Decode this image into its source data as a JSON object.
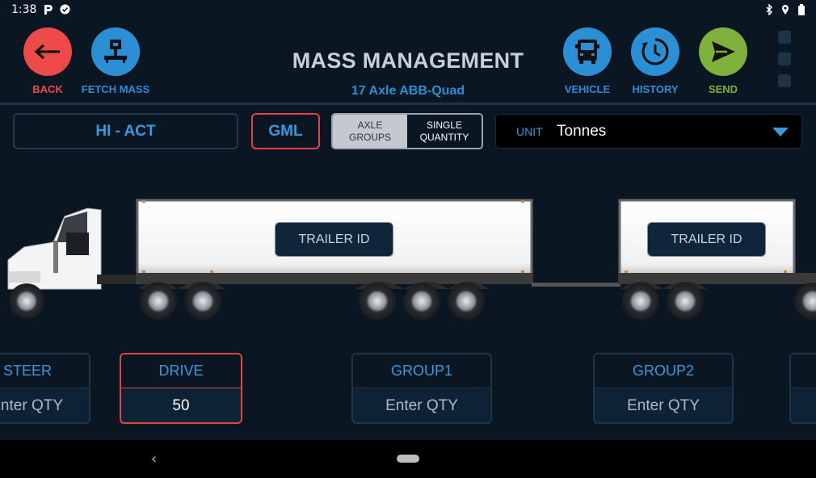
{
  "status_bar": {
    "time": "1:38"
  },
  "header": {
    "title": "MASS MANAGEMENT",
    "subtitle": "17 Axle  ABB-Quad",
    "back_label": "BACK",
    "fetch_mass_label": "FETCH MASS",
    "vehicle_label": "VEHICLE",
    "history_label": "HISTORY",
    "send_label": "SEND"
  },
  "controls": {
    "mode": "HI - ACT",
    "gml": "GML",
    "toggle_left_line1": "AXLE",
    "toggle_left_line2": "GROUPS",
    "toggle_right_line1": "SINGLE",
    "toggle_right_line2": "QUANTITY",
    "unit_label": "UNIT",
    "unit_value": "Tonnes"
  },
  "trailers": [
    {
      "id_label": "TRAILER ID"
    },
    {
      "id_label": "TRAILER ID"
    }
  ],
  "axle_cards": [
    {
      "name": "STEER",
      "value": "Enter QTY"
    },
    {
      "name": "DRIVE",
      "value": "50"
    },
    {
      "name": "GROUP1",
      "value": "Enter QTY"
    },
    {
      "name": "GROUP2",
      "value": "Enter QTY"
    }
  ],
  "colors": {
    "background": "#0b1623",
    "back_red": "#ef4a4a",
    "blue": "#2b8fd6",
    "send_green": "#7fb23a",
    "active_border": "#e04444"
  }
}
